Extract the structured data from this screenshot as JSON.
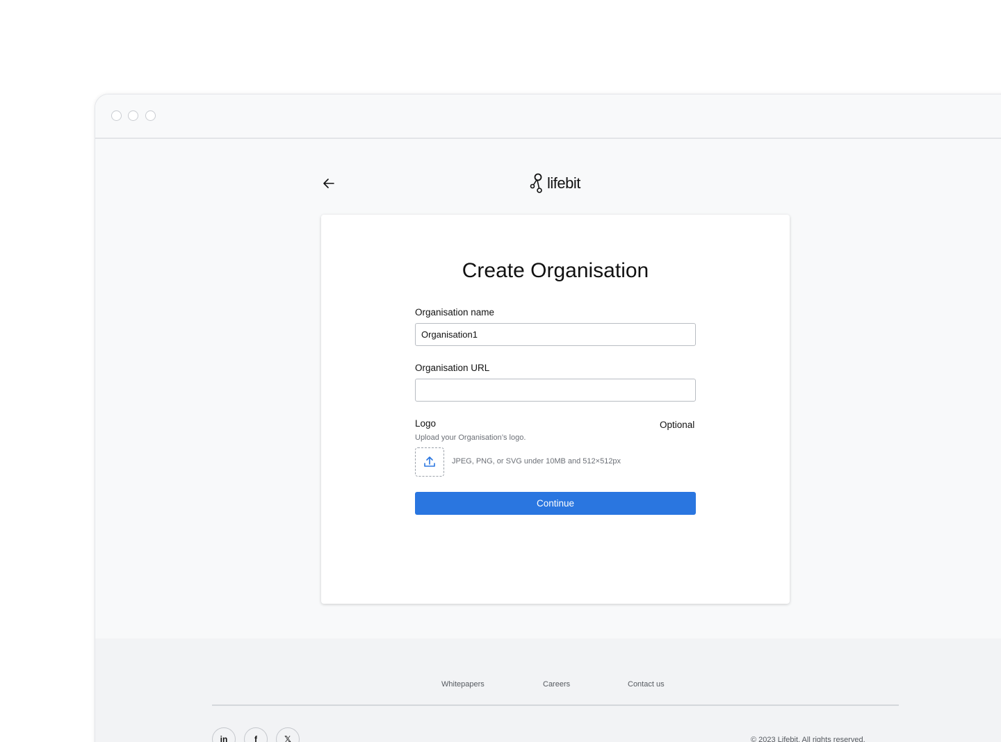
{
  "header": {
    "logo_text": "lifebit"
  },
  "form": {
    "title": "Create Organisation",
    "name_label": "Organisation name",
    "name_value": "Organisation1",
    "url_label": "Organisation URL",
    "url_value": "",
    "logo_label": "Logo",
    "optional_label": "Optional",
    "logo_help": "Upload your Organisation’s logo.",
    "logo_hint": "JPEG, PNG, or SVG under 10MB and 512×512px",
    "continue_label": "Continue"
  },
  "footer": {
    "links": [
      "Whitepapers",
      "Careers",
      "Contact us"
    ],
    "social": {
      "linkedin": "in",
      "facebook": "f",
      "x": "𝕏"
    },
    "copyright": "© 2023 Lifebit. All rights reserved."
  },
  "colors": {
    "accent": "#2a76e0",
    "window_bg": "#f8f9fa",
    "footer_bg": "#f2f3f5"
  }
}
